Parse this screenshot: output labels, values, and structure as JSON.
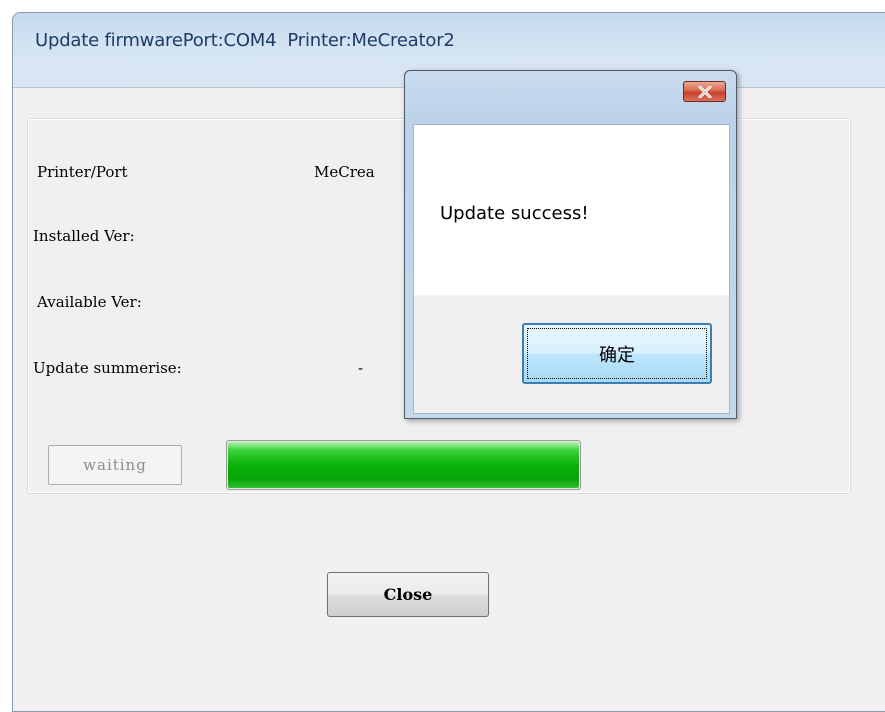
{
  "window": {
    "title": "Update firmwarePort:COM4  Printer:MeCreator2"
  },
  "info": {
    "printer_port_label": "Printer/Port",
    "printer_port_value": "MeCrea",
    "installed_label": "Installed Ver:",
    "available_label": "Available Ver:",
    "summary_label": "Update summerise:",
    "summary_value": "-"
  },
  "status": {
    "button_label": "waiting",
    "progress_fraction": 1.0,
    "progress_color": "#0ab30a"
  },
  "footer": {
    "close_label": "Close"
  },
  "message_box": {
    "text": "Update success!",
    "ok_label": "确定",
    "close_icon": "close-icon",
    "close_button_color": "#c7402a"
  }
}
